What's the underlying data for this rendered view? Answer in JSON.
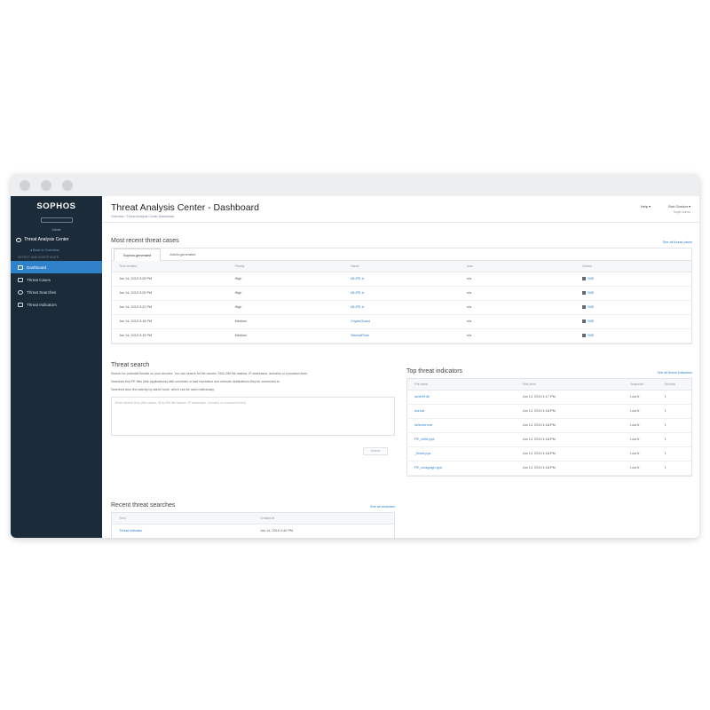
{
  "window": {
    "buttons": [
      "close",
      "minimize",
      "maximize"
    ]
  },
  "sidebar": {
    "brand": "SOPHOS",
    "brand_chip": "",
    "brand_sub": "Admin",
    "section": "Threat Analysis Center",
    "back_link": "Back to Overview",
    "category": "DETECT AND INVESTIGATE",
    "items": [
      {
        "label": "Dashboard",
        "icon": "dashboard-icon",
        "active": true
      },
      {
        "label": "Threat Cases",
        "icon": "cases-icon",
        "active": false
      },
      {
        "label": "Threat Searches",
        "icon": "search-icon",
        "active": false
      },
      {
        "label": "Threat Indicators",
        "icon": "indicator-icon",
        "active": false
      }
    ]
  },
  "header": {
    "title": "Threat Analysis Center - Dashboard",
    "breadcrumb": "Overview  /  Threat Analysis Center Dashboard",
    "help": "Help ▾",
    "user": "Rob Gordon ▾",
    "user_role": "Super Admin"
  },
  "cases": {
    "title": "Most recent threat cases",
    "see_all": "See all threat cases",
    "tabs": [
      "Sophos-generated",
      "Admin-generated"
    ],
    "columns": [
      "Time created",
      "Priority",
      "Name",
      "User",
      "Device"
    ],
    "rows": [
      [
        "Jun 14, 2019 3:28 PM",
        "High",
        "ML/PE-A",
        "n/a",
        "B55"
      ],
      [
        "Jun 14, 2019 3:25 PM",
        "High",
        "ML/PE-A",
        "n/a",
        "B55"
      ],
      [
        "Jun 14, 2019 3:22 PM",
        "High",
        "ML/PE-A",
        "n/a",
        "B55"
      ],
      [
        "Jun 14, 2019 3:18 PM",
        "Medium",
        "CryptoGuard",
        "n/a",
        "B55"
      ],
      [
        "Jun 14, 2019 3:15 PM",
        "Medium",
        "WannaPeas",
        "n/a",
        "B55"
      ]
    ]
  },
  "search": {
    "title": "Threat search",
    "p1": "Search for potential threats on your devices. You can search for file names, SHA-256 file hashes, IP addresses, domains or command lines.",
    "p2": "Searches find PE files (like applications) with uncertain or bad reputation and network destinations they've connected to.",
    "p3": "Searches also find activity by admin tools, which can be used maliciously.",
    "placeholder": "Enter search term (file names, SHA-256 file hashes, IP addresses, domains or command lines)",
    "button": "Search"
  },
  "indicators": {
    "title": "Top threat indicators",
    "see_all": "See all threat indicators",
    "columns": [
      "File name",
      "First seen",
      "Suspicion",
      "Devices"
    ],
    "rows": [
      [
        "lavie09.dll",
        "Jun 14, 2019 1:17 PM",
        "Low 6",
        "1"
      ],
      [
        "lea.bat",
        "Jun 14, 2019 1:18 PM",
        "Low 6",
        "1"
      ],
      [
        "selector.exe",
        "Jun 14, 2019 1:18 PM",
        "Low 6",
        "1"
      ],
      [
        "PE_vnfel.pyd",
        "Jun 14, 2019 1:18 PM",
        "Low 6",
        "1"
      ],
      [
        "_flchet.pyd",
        "Jun 14, 2019 1:18 PM",
        "Low 6",
        "1"
      ],
      [
        "PE_cmagnigh.pyd",
        "Jun 14, 2019 1:18 PM",
        "Low 6",
        "1"
      ]
    ]
  },
  "recent": {
    "title": "Recent threat searches",
    "see_all": "See all searches",
    "columns": [
      "Term",
      "Created at"
    ],
    "rows": [
      [
        "Threat indicator",
        "Jun 14, 2019 2:40 PM"
      ]
    ]
  },
  "colors": {
    "sidebar": "#1c2b3a",
    "accent": "#2f81c9",
    "active": "#2f81c9"
  }
}
